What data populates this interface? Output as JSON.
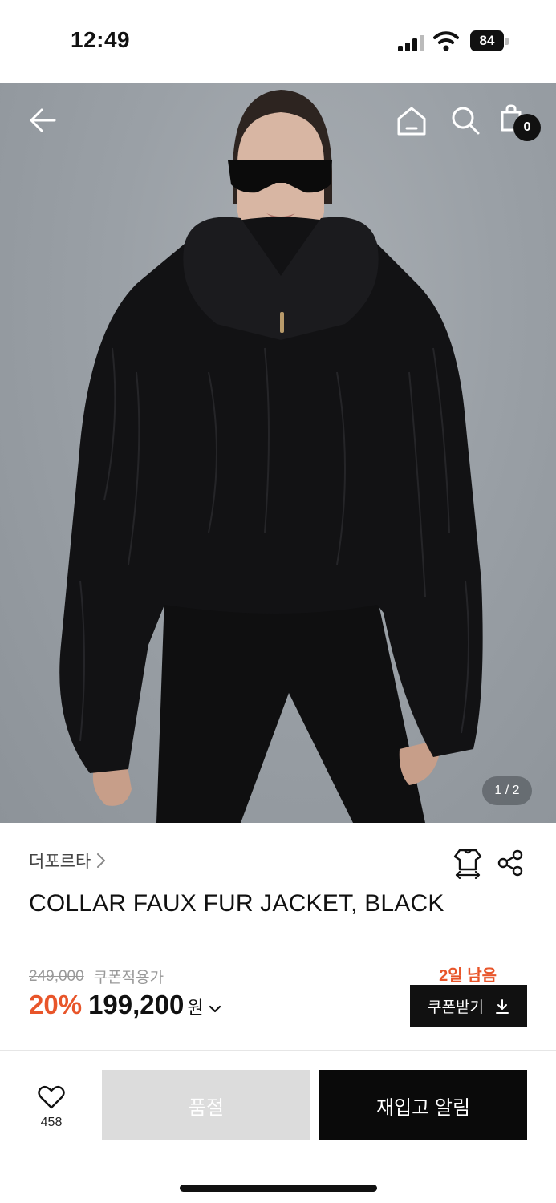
{
  "status_bar": {
    "time": "12:49",
    "battery": "84",
    "icons": [
      "signal-icon",
      "wifi-icon",
      "battery-icon"
    ]
  },
  "header": {
    "icons": [
      "back-arrow-icon",
      "home-icon",
      "search-icon",
      "shopping-bag-icon"
    ],
    "cart_count": "0"
  },
  "gallery": {
    "pager": "1 / 2",
    "current": 1,
    "total": 2
  },
  "product": {
    "brand": "더포르타",
    "title": "COLLAR FAUX FUR JACKET, BLACK",
    "original_price": "249,000",
    "coupon_label": "쿠폰적용가",
    "discount": "20%",
    "sale_price": "199,200",
    "currency": "원",
    "days_left": "2일 남음",
    "coupon_button": "쿠폰받기",
    "accent_color": "#e8552a"
  },
  "actions": {
    "like_count": "458",
    "soldout_label": "품절",
    "restock_label": "재입고 알림"
  }
}
